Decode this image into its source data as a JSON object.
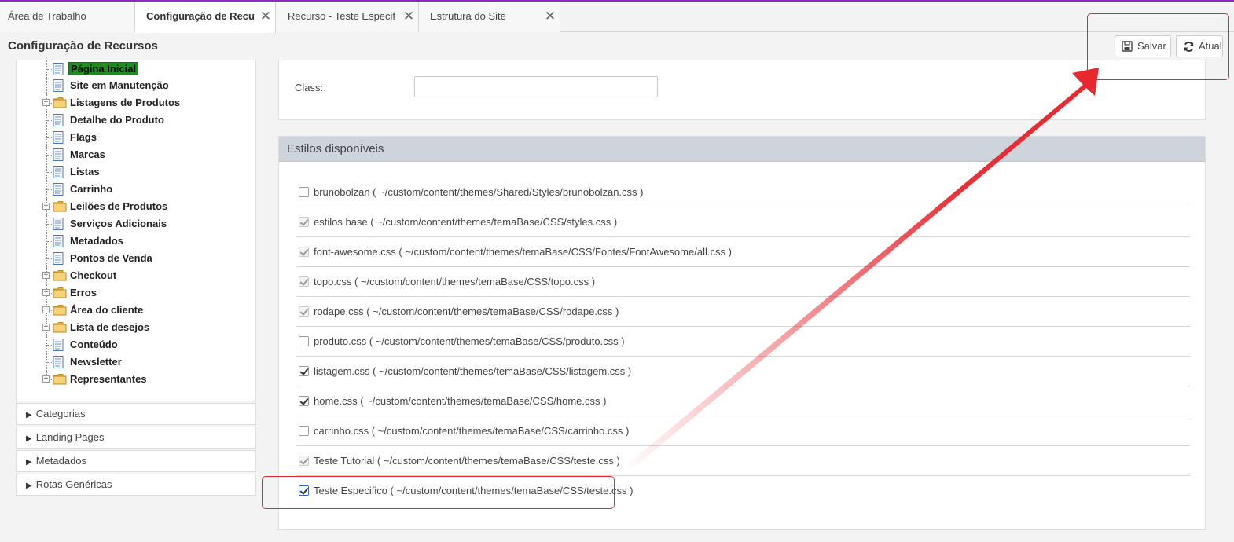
{
  "tabs": [
    {
      "label": "Área de Trabalho",
      "closable": false
    },
    {
      "label": "Configuração de Recursos",
      "closable": true,
      "active": true
    },
    {
      "label": "Recurso - Teste Especifico",
      "closable": true
    },
    {
      "label": "Estrutura do Site",
      "closable": true
    }
  ],
  "header": {
    "title": "Configuração de Recursos",
    "save_label": "Salvar",
    "refresh_label": "Atualizar"
  },
  "tree": {
    "items": [
      {
        "label": "Página Inicial",
        "type": "page",
        "selected": true
      },
      {
        "label": "Site em Manutenção",
        "type": "page"
      },
      {
        "label": "Listagens de Produtos",
        "type": "folder"
      },
      {
        "label": "Detalhe do Produto",
        "type": "page"
      },
      {
        "label": "Flags",
        "type": "page"
      },
      {
        "label": "Marcas",
        "type": "page"
      },
      {
        "label": "Listas",
        "type": "page"
      },
      {
        "label": "Carrinho",
        "type": "page"
      },
      {
        "label": "Leilões de Produtos",
        "type": "folder"
      },
      {
        "label": "Serviços Adicionais",
        "type": "page"
      },
      {
        "label": "Metadados",
        "type": "page"
      },
      {
        "label": "Pontos de Venda",
        "type": "page"
      },
      {
        "label": "Checkout",
        "type": "folder"
      },
      {
        "label": "Erros",
        "type": "folder"
      },
      {
        "label": "Área do cliente",
        "type": "folder"
      },
      {
        "label": "Lista de desejos",
        "type": "folder"
      },
      {
        "label": "Conteúdo",
        "type": "page"
      },
      {
        "label": "Newsletter",
        "type": "page"
      },
      {
        "label": "Representantes",
        "type": "folder"
      }
    ]
  },
  "accordions": [
    {
      "label": "Categorias"
    },
    {
      "label": "Landing Pages"
    },
    {
      "label": "Metadados"
    },
    {
      "label": "Rotas Genéricas"
    }
  ],
  "class_field": {
    "label": "Class:",
    "value": ""
  },
  "styles": {
    "title": "Estilos disponíveis",
    "items": [
      {
        "label": "brunobolzan ( ~/custom/content/themes/Shared/Styles/brunobolzan.css )",
        "checked": false,
        "disabled": false
      },
      {
        "label": "estilos base ( ~/custom/content/themes/temaBase/CSS/styles.css )",
        "checked": true,
        "disabled": true
      },
      {
        "label": "font-awesome.css ( ~/custom/content/themes/temaBase/CSS/Fontes/FontAwesome/all.css )",
        "checked": true,
        "disabled": true
      },
      {
        "label": "topo.css ( ~/custom/content/themes/temaBase/CSS/topo.css )",
        "checked": true,
        "disabled": true
      },
      {
        "label": "rodape.css ( ~/custom/content/themes/temaBase/CSS/rodape.css )",
        "checked": true,
        "disabled": true
      },
      {
        "label": "produto.css ( ~/custom/content/themes/temaBase/CSS/produto.css )",
        "checked": false,
        "disabled": false
      },
      {
        "label": "listagem.css ( ~/custom/content/themes/temaBase/CSS/listagem.css )",
        "checked": true,
        "disabled": false
      },
      {
        "label": "home.css ( ~/custom/content/themes/temaBase/CSS/home.css )",
        "checked": true,
        "disabled": false
      },
      {
        "label": "carrinho.css ( ~/custom/content/themes/temaBase/CSS/carrinho.css )",
        "checked": false,
        "disabled": false
      },
      {
        "label": "Teste Tutorial ( ~/custom/content/themes/temaBase/CSS/teste.css )",
        "checked": true,
        "disabled": true
      },
      {
        "label": "Teste Especifico ( ~/custom/content/themes/temaBase/CSS/teste.css )",
        "checked": true,
        "disabled": false
      }
    ]
  },
  "colors": {
    "accent_top": "#8e2ac1",
    "selected_node": "#1e8c1e",
    "annotation": "#e8262d"
  }
}
